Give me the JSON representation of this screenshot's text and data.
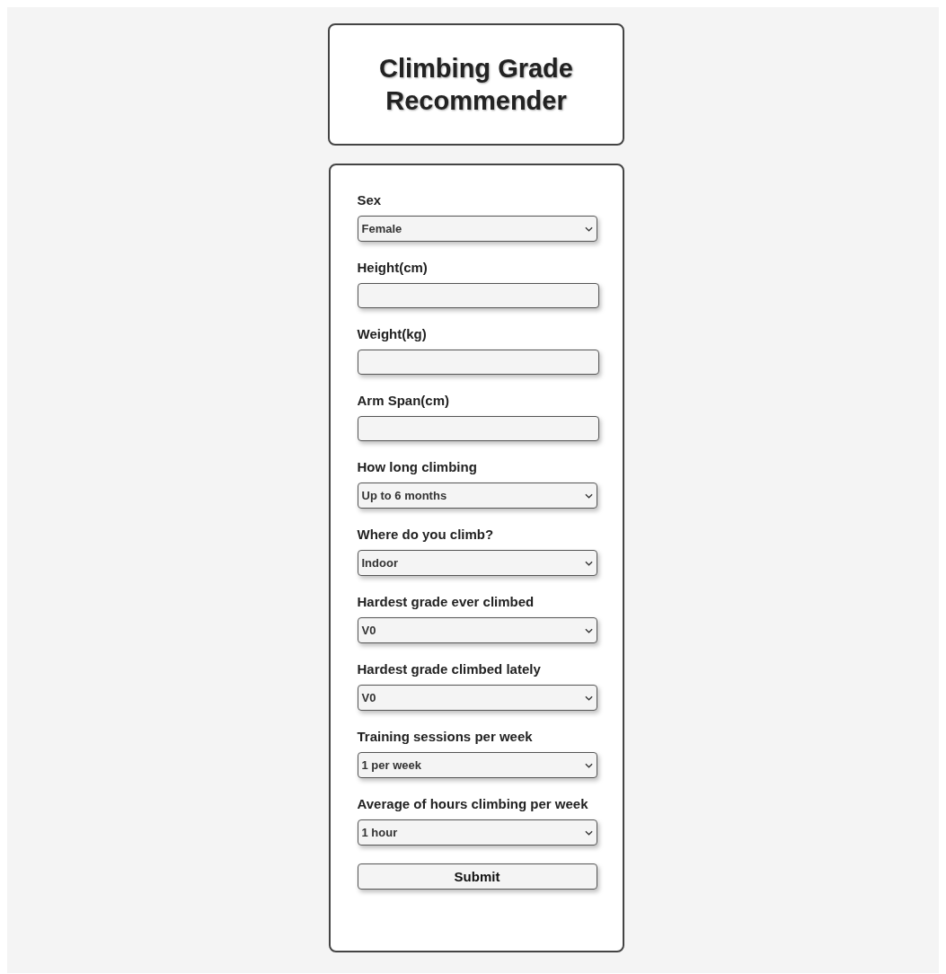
{
  "title": "Climbing Grade Recommender",
  "fields": [
    {
      "label": "Sex",
      "kind": "select",
      "value": "Female"
    },
    {
      "label": "Height(cm)",
      "kind": "text"
    },
    {
      "label": "Weight(kg)",
      "kind": "text"
    },
    {
      "label": "Arm Span(cm)",
      "kind": "text"
    },
    {
      "label": "How long climbing",
      "kind": "select",
      "value": "Up to 6 months"
    },
    {
      "label": "Where do you climb?",
      "kind": "select",
      "value": "Indoor"
    },
    {
      "label": "Hardest grade ever climbed",
      "kind": "select",
      "value": "V0"
    },
    {
      "label": "Hardest grade climbed lately",
      "kind": "select",
      "value": "V0"
    },
    {
      "label": "Training sessions per week",
      "kind": "select",
      "value": "1 per week"
    },
    {
      "label": "Average of hours climbing per week",
      "kind": "select",
      "value": "1 hour"
    }
  ],
  "submit": "Submit"
}
